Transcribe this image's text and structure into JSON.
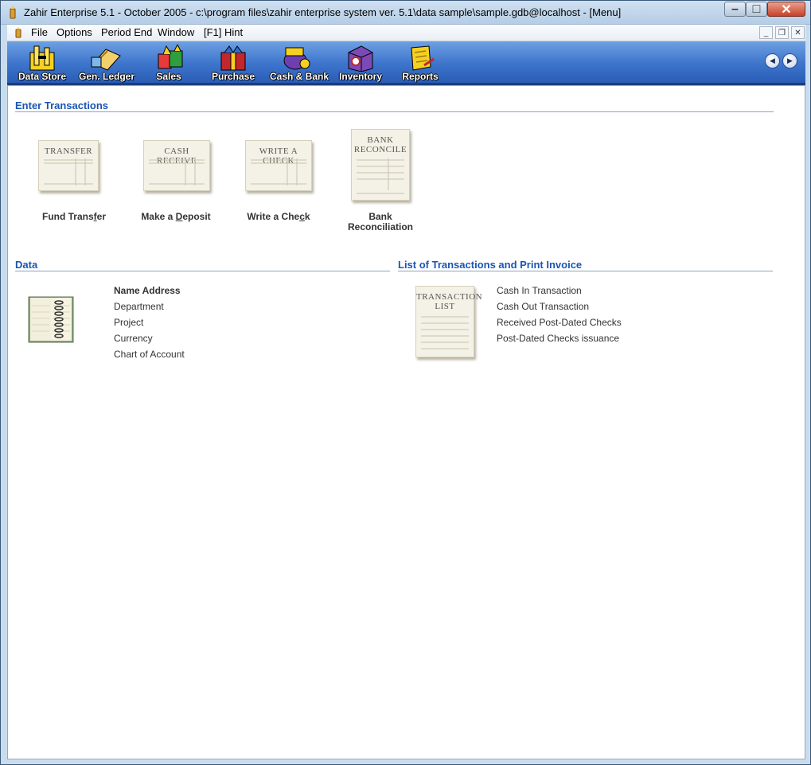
{
  "window": {
    "title": "Zahir Enterprise 5.1 - October 2005 - c:\\program files\\zahir enterprise system ver. 5.1\\data sample\\sample.gdb@localhost - [Menu]",
    "controls": {
      "minimize": "–",
      "maximize": "□",
      "close": "✕"
    }
  },
  "menubar": {
    "items": [
      "File",
      "Options",
      "Period End",
      "Window",
      "[F1] Hint"
    ],
    "mdi": {
      "minimize": "_",
      "restore": "❐",
      "close": "✕"
    }
  },
  "toolbar": {
    "items": [
      {
        "label": "Data Store",
        "icon": "data-store-icon"
      },
      {
        "label": "Gen. Ledger",
        "icon": "general-ledger-icon"
      },
      {
        "label": "Sales",
        "icon": "sales-icon"
      },
      {
        "label": "Purchase",
        "icon": "purchase-icon"
      },
      {
        "label": "Cash & Bank",
        "icon": "cash-bank-icon"
      },
      {
        "label": "Inventory",
        "icon": "inventory-icon"
      },
      {
        "label": "Reports",
        "icon": "reports-icon"
      }
    ],
    "nav": {
      "prev": "◀",
      "next": "▶"
    }
  },
  "enter_transactions": {
    "title": "Enter Transactions",
    "items": [
      {
        "form_title": "TRANSFER",
        "caption_pre": "Fund Trans",
        "caption_u": "f",
        "caption_post": "er"
      },
      {
        "form_title": "CASH RECEIVE",
        "caption_pre": "Make a ",
        "caption_u": "D",
        "caption_post": "eposit"
      },
      {
        "form_title": "WRITE A CHECK",
        "caption_pre": "Write a Che",
        "caption_u": "c",
        "caption_post": "k"
      },
      {
        "form_title_1": "BANK",
        "form_title_2": "RECONCILE",
        "caption_1": "Bank",
        "caption_2": "Reconciliation"
      }
    ]
  },
  "data_section": {
    "title": "Data",
    "links": [
      "Name Address",
      "Department",
      "Project",
      "Currency",
      "Chart of Account"
    ]
  },
  "list_section": {
    "title": "List of Transactions and  Print Invoice",
    "card_title_1": "TRANSACTION",
    "card_title_2": "LIST",
    "links": [
      "Cash In Transaction",
      "Cash Out Transaction",
      "Received Post-Dated Checks",
      "Post-Dated Checks issuance"
    ]
  },
  "colors": {
    "section_title": "#1a55b4",
    "toolbar": "#3d74cc"
  }
}
